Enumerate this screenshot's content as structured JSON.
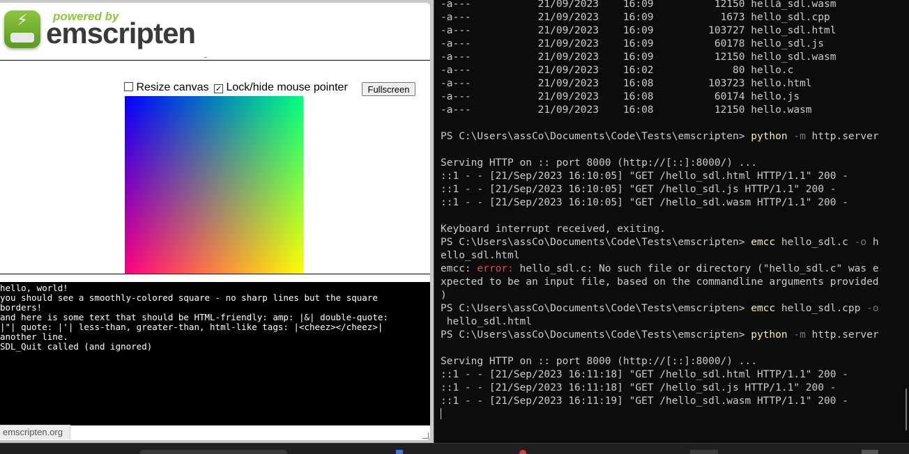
{
  "browser": {
    "header": {
      "powered_by": "powered by",
      "brand": "emscripten"
    },
    "controls": {
      "resize_canvas_label": "Resize canvas",
      "resize_canvas_checked": false,
      "lock_pointer_label": "Lock/hide mouse pointer",
      "lock_pointer_checked": true,
      "fullscreen_label": "Fullscreen"
    },
    "output_lines": [
      "hello, world!",
      "you should see a smoothly-colored square - no sharp lines but the square",
      "borders!",
      "and here is some text that should be HTML-friendly: amp: |&| double-quote:",
      "|\"| quote: |'| less-than, greater-than, html-like tags: |<cheez></cheez>|",
      "another line.",
      "SDL_Quit called (and ignored)"
    ],
    "status_link": "emscripten.org"
  },
  "terminal": {
    "lines": [
      [
        {
          "t": "-a---           21/09/2023    16:09          12150 hellà_sdl.wasm",
          "c": ""
        }
      ],
      [
        {
          "t": "-a---           21/09/2023    16:09           1673 hello_sdl.cpp",
          "c": ""
        }
      ],
      [
        {
          "t": "-a---           21/09/2023    16:09         103727 hello_sdl.html",
          "c": ""
        }
      ],
      [
        {
          "t": "-a---           21/09/2023    16:09          60178 hello_sdl.js",
          "c": ""
        }
      ],
      [
        {
          "t": "-a---           21/09/2023    16:09          12150 hello_sdl.wasm",
          "c": ""
        }
      ],
      [
        {
          "t": "-a---           21/09/2023    16:02             80 hello.c",
          "c": ""
        }
      ],
      [
        {
          "t": "-a---           21/09/2023    16:08         103723 hello.html",
          "c": ""
        }
      ],
      [
        {
          "t": "-a---           21/09/2023    16:08          60174 hello.js",
          "c": ""
        }
      ],
      [
        {
          "t": "-a---           21/09/2023    16:08          12150 hello.wasm",
          "c": ""
        }
      ],
      [
        {
          "t": "",
          "c": ""
        }
      ],
      [
        {
          "t": "PS C:\\Users\\assCo\\Documents\\Code\\Tests\\emscripten> ",
          "c": ""
        },
        {
          "t": "python",
          "c": "cmd"
        },
        {
          "t": " -m",
          "c": "flag"
        },
        {
          "t": " http.server",
          "c": ""
        }
      ],
      [
        {
          "t": "",
          "c": ""
        }
      ],
      [
        {
          "t": "Serving HTTP on :: port 8000 (http://[::]:8000/) ...",
          "c": ""
        }
      ],
      [
        {
          "t": "::1 - - [21/Sep/2023 16:10:05] \"GET /hello_sdl.html HTTP/1.1\" 200 -",
          "c": ""
        }
      ],
      [
        {
          "t": "::1 - - [21/Sep/2023 16:10:05] \"GET /hello_sdl.js HTTP/1.1\" 200 -",
          "c": ""
        }
      ],
      [
        {
          "t": "::1 - - [21/Sep/2023 16:10:05] \"GET /hello_sdl.wasm HTTP/1.1\" 200 -",
          "c": ""
        }
      ],
      [
        {
          "t": "",
          "c": ""
        }
      ],
      [
        {
          "t": "Keyboard interrupt received, exiting.",
          "c": ""
        }
      ],
      [
        {
          "t": "PS C:\\Users\\assCo\\Documents\\Code\\Tests\\emscripten> ",
          "c": ""
        },
        {
          "t": "emcc",
          "c": "cmd"
        },
        {
          "t": " hello_sdl.c",
          "c": ""
        },
        {
          "t": " -o",
          "c": "flag"
        },
        {
          "t": " h",
          "c": ""
        }
      ],
      [
        {
          "t": "ello_sdl.html",
          "c": ""
        }
      ],
      [
        {
          "t": "emcc: ",
          "c": ""
        },
        {
          "t": "error:",
          "c": "err"
        },
        {
          "t": " hello_sdl.c: No such file or directory (\"hello_sdl.c\" was e",
          "c": ""
        }
      ],
      [
        {
          "t": "xpected to be an input file, based on the commandline arguments provided",
          "c": ""
        }
      ],
      [
        {
          "t": ")",
          "c": ""
        }
      ],
      [
        {
          "t": "PS C:\\Users\\assCo\\Documents\\Code\\Tests\\emscripten> ",
          "c": ""
        },
        {
          "t": "emcc",
          "c": "cmd"
        },
        {
          "t": " hello_sdl.cpp",
          "c": ""
        },
        {
          "t": " -o",
          "c": "flag"
        }
      ],
      [
        {
          "t": " hello_sdl.html",
          "c": ""
        }
      ],
      [
        {
          "t": "PS C:\\Users\\assCo\\Documents\\Code\\Tests\\emscripten> ",
          "c": ""
        },
        {
          "t": "python",
          "c": "cmd"
        },
        {
          "t": " -m",
          "c": "flag"
        },
        {
          "t": " http.server",
          "c": ""
        }
      ],
      [
        {
          "t": "",
          "c": ""
        }
      ],
      [
        {
          "t": "Serving HTTP on :: port 8000 (http://[::]:8000/) ...",
          "c": ""
        }
      ],
      [
        {
          "t": "::1 - - [21/Sep/2023 16:11:18] \"GET /hello_sdl.html HTTP/1.1\" 200 -",
          "c": ""
        }
      ],
      [
        {
          "t": "::1 - - [21/Sep/2023 16:11:18] \"GET /hello_sdl.js HTTP/1.1\" 200 -",
          "c": ""
        }
      ],
      [
        {
          "t": "::1 - - [21/Sep/2023 16:11:19] \"GET /hello_sdl.wasm HTTP/1.1\" 200 -",
          "c": ""
        }
      ]
    ]
  },
  "colors": {
    "terminal_text": "#cccccc",
    "command": "#f9f1a5",
    "flag": "#767676",
    "error": "#e74856",
    "brand_green": "#8cc63f"
  },
  "icons": {
    "logo": "emscripten-bolt-logo",
    "checkbox_checked": "checkmark-icon"
  }
}
